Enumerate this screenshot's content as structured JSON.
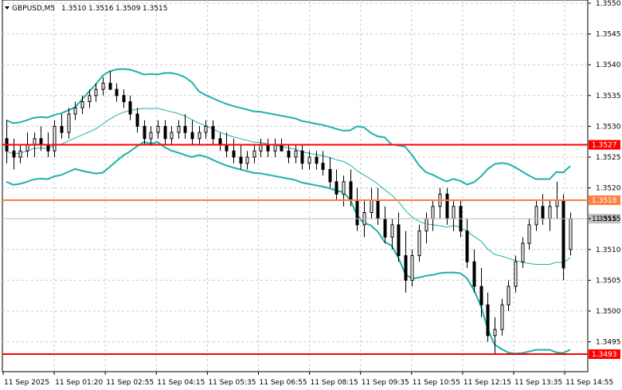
{
  "header": {
    "symbol": "GBPUSD,M5",
    "open": "1.3510",
    "high": "1.3516",
    "low": "1.3509",
    "close": "1.3515"
  },
  "chart_data": {
    "type": "candlestick",
    "symbol": "GBPUSD",
    "timeframe": "M5",
    "y_ticks": [
      "1.3550",
      "1.3545",
      "1.3540",
      "1.3535",
      "1.3530",
      "1.3525",
      "1.3520",
      "1.3515",
      "1.3510",
      "1.3505",
      "1.3500",
      "1.3495"
    ],
    "x_ticks": [
      "11 Sep 2025",
      "11 Sep 01:20",
      "11 Sep 02:55",
      "11 Sep 04:15",
      "11 Sep 05:35",
      "11 Sep 06:55",
      "11 Sep 08:15",
      "11 Sep 09:35",
      "11 Sep 10:55",
      "11 Sep 12:15",
      "11 Sep 13:35",
      "11 Sep 14:55"
    ],
    "ylim": [
      1.3491,
      1.3551
    ],
    "grid": true,
    "horizontal_levels": [
      {
        "value": 1.3527,
        "label": "1.3527",
        "color": "#ff0000"
      },
      {
        "value": 1.3518,
        "label": "1.3518",
        "color": "#ff7f3f"
      },
      {
        "value": 1.3493,
        "label": "1.3493",
        "color": "#ff0000"
      }
    ],
    "current_price": {
      "value": 1.3515,
      "label": "1.3515"
    },
    "candles": [
      [
        1.3528,
        1.3531,
        1.3524,
        1.3526
      ],
      [
        1.3526,
        1.3528,
        1.3523,
        1.3525
      ],
      [
        1.3525,
        1.3527,
        1.3524,
        1.3526
      ],
      [
        1.3526,
        1.3529,
        1.3525,
        1.3527
      ],
      [
        1.3527,
        1.3529,
        1.3525,
        1.3528
      ],
      [
        1.3528,
        1.353,
        1.3526,
        1.3527
      ],
      [
        1.3527,
        1.3529,
        1.3525,
        1.3526
      ],
      [
        1.3526,
        1.3531,
        1.3525,
        1.353
      ],
      [
        1.353,
        1.3532,
        1.3528,
        1.3529
      ],
      [
        1.3529,
        1.3533,
        1.3528,
        1.3532
      ],
      [
        1.3532,
        1.3534,
        1.3531,
        1.3533
      ],
      [
        1.3533,
        1.3535,
        1.3532,
        1.3534
      ],
      [
        1.3534,
        1.3536,
        1.3533,
        1.3535
      ],
      [
        1.3535,
        1.3537,
        1.3534,
        1.3536
      ],
      [
        1.3536,
        1.3538,
        1.3535,
        1.3537
      ],
      [
        1.3537,
        1.3539,
        1.3536,
        1.3536
      ],
      [
        1.3536,
        1.3537,
        1.3534,
        1.3535
      ],
      [
        1.3535,
        1.3536,
        1.3533,
        1.3534
      ],
      [
        1.3534,
        1.3535,
        1.3531,
        1.3532
      ],
      [
        1.3532,
        1.3533,
        1.3529,
        1.353
      ],
      [
        1.353,
        1.3531,
        1.3527,
        1.3528
      ],
      [
        1.3528,
        1.353,
        1.3527,
        1.3529
      ],
      [
        1.3529,
        1.3531,
        1.3528,
        1.353
      ],
      [
        1.353,
        1.3531,
        1.3527,
        1.3528
      ],
      [
        1.3528,
        1.353,
        1.3527,
        1.3529
      ],
      [
        1.3529,
        1.3531,
        1.3528,
        1.353
      ],
      [
        1.353,
        1.3532,
        1.3528,
        1.3529
      ],
      [
        1.3529,
        1.3531,
        1.3527,
        1.3528
      ],
      [
        1.3528,
        1.353,
        1.3527,
        1.3529
      ],
      [
        1.3529,
        1.3531,
        1.3528,
        1.353
      ],
      [
        1.353,
        1.3531,
        1.3527,
        1.3528
      ],
      [
        1.3528,
        1.3529,
        1.3526,
        1.3527
      ],
      [
        1.3527,
        1.3529,
        1.3525,
        1.3526
      ],
      [
        1.3526,
        1.3528,
        1.3524,
        1.3525
      ],
      [
        1.3525,
        1.3527,
        1.3523,
        1.3524
      ],
      [
        1.3524,
        1.3526,
        1.3523,
        1.3525
      ],
      [
        1.3525,
        1.3527,
        1.3524,
        1.3526
      ],
      [
        1.3526,
        1.3528,
        1.3525,
        1.3527
      ],
      [
        1.3527,
        1.3528,
        1.3525,
        1.3526
      ],
      [
        1.3526,
        1.3528,
        1.3525,
        1.3527
      ],
      [
        1.3527,
        1.3528,
        1.3526,
        1.3526
      ],
      [
        1.3526,
        1.3527,
        1.3524,
        1.3525
      ],
      [
        1.3525,
        1.3527,
        1.3524,
        1.3526
      ],
      [
        1.3526,
        1.3527,
        1.3523,
        1.3524
      ],
      [
        1.3524,
        1.3526,
        1.3523,
        1.3525
      ],
      [
        1.3525,
        1.3526,
        1.3523,
        1.3524
      ],
      [
        1.3524,
        1.3526,
        1.3522,
        1.3523
      ],
      [
        1.3523,
        1.3525,
        1.352,
        1.3521
      ],
      [
        1.3521,
        1.3523,
        1.3518,
        1.3519
      ],
      [
        1.3519,
        1.3522,
        1.3517,
        1.3521
      ],
      [
        1.3521,
        1.3523,
        1.3517,
        1.3518
      ],
      [
        1.3518,
        1.352,
        1.3513,
        1.3514
      ],
      [
        1.3514,
        1.3518,
        1.3512,
        1.3516
      ],
      [
        1.3516,
        1.352,
        1.3515,
        1.3518
      ],
      [
        1.3518,
        1.352,
        1.3514,
        1.3515
      ],
      [
        1.3515,
        1.3517,
        1.3511,
        1.3512
      ],
      [
        1.3512,
        1.3515,
        1.351,
        1.3514
      ],
      [
        1.3514,
        1.3516,
        1.3508,
        1.3509
      ],
      [
        1.3509,
        1.3513,
        1.3503,
        1.3505
      ],
      [
        1.3505,
        1.351,
        1.3504,
        1.3509
      ],
      [
        1.3509,
        1.3514,
        1.3508,
        1.3513
      ],
      [
        1.3513,
        1.3516,
        1.3511,
        1.3515
      ],
      [
        1.3515,
        1.3518,
        1.3513,
        1.3517
      ],
      [
        1.3517,
        1.352,
        1.3515,
        1.3519
      ],
      [
        1.3519,
        1.352,
        1.3514,
        1.3515
      ],
      [
        1.3515,
        1.3518,
        1.3513,
        1.3517
      ],
      [
        1.3517,
        1.3518,
        1.3512,
        1.3513
      ],
      [
        1.3513,
        1.3515,
        1.3507,
        1.3508
      ],
      [
        1.3508,
        1.351,
        1.3503,
        1.3504
      ],
      [
        1.3504,
        1.3507,
        1.3499,
        1.3501
      ],
      [
        1.3501,
        1.3503,
        1.3495,
        1.3496
      ],
      [
        1.3496,
        1.3499,
        1.3493,
        1.3497
      ],
      [
        1.3497,
        1.3502,
        1.3496,
        1.3501
      ],
      [
        1.3501,
        1.3505,
        1.35,
        1.3504
      ],
      [
        1.3504,
        1.3509,
        1.3503,
        1.3508
      ],
      [
        1.3508,
        1.3512,
        1.3507,
        1.3511
      ],
      [
        1.3511,
        1.3515,
        1.351,
        1.3514
      ],
      [
        1.3514,
        1.3518,
        1.3513,
        1.3517
      ],
      [
        1.3517,
        1.3519,
        1.3514,
        1.3515
      ],
      [
        1.3515,
        1.3518,
        1.3513,
        1.3517
      ],
      [
        1.3517,
        1.3521,
        1.3515,
        1.3518
      ],
      [
        1.3518,
        1.3519,
        1.3505,
        1.3507
      ],
      [
        1.351,
        1.3516,
        1.3509,
        1.3515
      ]
    ],
    "indicator": "Bollinger Bands"
  },
  "colors": {
    "grid": "#c8ccd4",
    "candle": "#000000",
    "bands": "#20b2aa",
    "level_red": "#ff0000",
    "level_orange": "#ff7f3f",
    "current_bg": "#c0c0c0"
  }
}
